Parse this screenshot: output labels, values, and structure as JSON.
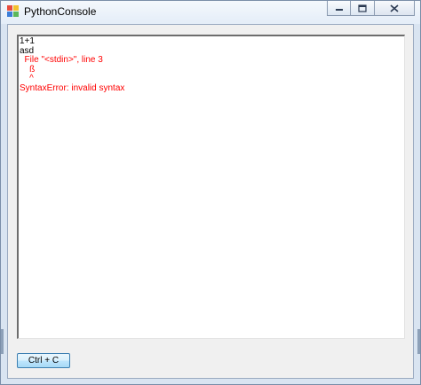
{
  "window": {
    "title": "PythonConsole",
    "title_icon": "windows-forms-icon",
    "controls": {
      "minimize_icon": "minimize-icon",
      "maximize_icon": "maximize-icon",
      "close_icon": "close-icon"
    }
  },
  "console": {
    "lines": [
      {
        "text": "1+1",
        "kind": "input"
      },
      {
        "text": "asd",
        "kind": "input"
      },
      {
        "text": "  File \"<stdin>\", line 3",
        "kind": "error"
      },
      {
        "text": "    ß",
        "kind": "error"
      },
      {
        "text": "    ^",
        "kind": "error"
      },
      {
        "text": "SyntaxError: invalid syntax",
        "kind": "error"
      }
    ],
    "colors": {
      "input": "#000000",
      "error": "#ff0000"
    }
  },
  "buttons": {
    "copy_label": "Ctrl + C"
  }
}
